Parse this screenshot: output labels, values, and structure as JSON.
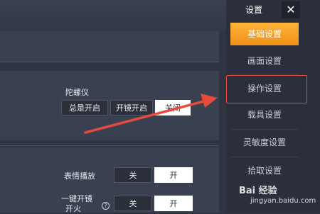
{
  "settings": {
    "gyroscope": {
      "label": "陀螺仪",
      "options": [
        "总是开启",
        "开镜开启",
        "关闭"
      ],
      "selected_visible": "关闭"
    },
    "emote_play": {
      "label": "表情播放",
      "off": "关",
      "on": "开"
    },
    "one_key_scope_fire": {
      "label_line1": "一键开镜",
      "label_line2": "开火",
      "help": "?",
      "off": "关",
      "on": "开"
    }
  },
  "sidebar": {
    "title": "设置",
    "close": "✕",
    "items": [
      {
        "label": "基础设置"
      },
      {
        "label": "画面设置"
      },
      {
        "label": "操作设置"
      },
      {
        "label": "载具设置"
      },
      {
        "label": "灵敏度设置"
      },
      {
        "label": "拾取设置"
      }
    ]
  },
  "watermark": {
    "main": "Bai 经验",
    "sub": "jingyan.baidu.com"
  },
  "colors": {
    "accent": "#f08f18",
    "annotation": "#e74a3a"
  }
}
